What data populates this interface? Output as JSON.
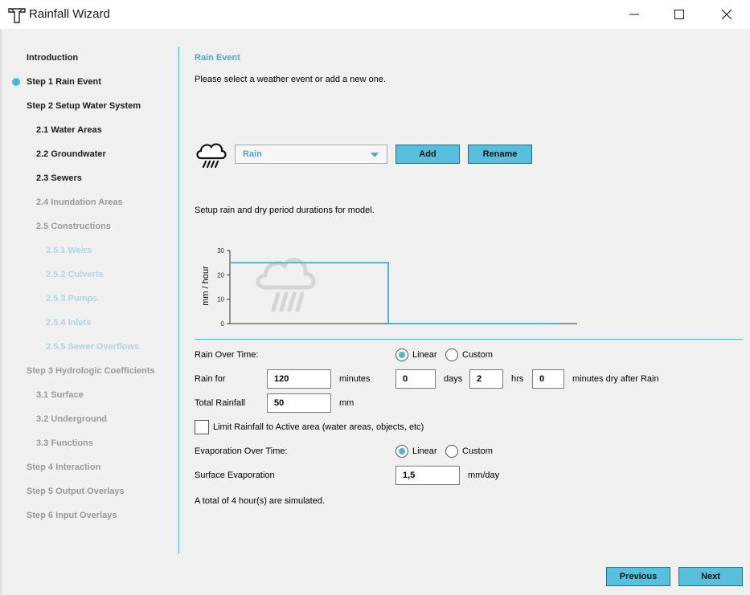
{
  "window": {
    "title": "Rainfall Wizard"
  },
  "sidebar": {
    "items": [
      {
        "label": "Introduction",
        "state": "done"
      },
      {
        "label": "Step 1 Rain Event",
        "state": "current"
      },
      {
        "label": "Step 2 Setup Water System",
        "state": "done"
      },
      {
        "label": "2.1 Water Areas",
        "state": "done"
      },
      {
        "label": "2.2 Groundwater",
        "state": "done"
      },
      {
        "label": "2.3 Sewers",
        "state": "done"
      },
      {
        "label": "2.4 Inundation Areas",
        "state": "future"
      },
      {
        "label": "2.5 Constructions",
        "state": "future"
      },
      {
        "label": "2.5.1 Weirs",
        "state": "disabled"
      },
      {
        "label": "2.5.2 Culverts",
        "state": "disabled"
      },
      {
        "label": "2.5.3 Pumps",
        "state": "disabled"
      },
      {
        "label": "2.5.4 Inlets",
        "state": "disabled"
      },
      {
        "label": "2.5.5 Sewer Overflows",
        "state": "disabled"
      },
      {
        "label": "Step 3 Hydrologic Coefficients",
        "state": "future"
      },
      {
        "label": "3.1 Surface",
        "state": "future"
      },
      {
        "label": "3.2 Underground",
        "state": "future"
      },
      {
        "label": "3.3 Functions",
        "state": "future"
      },
      {
        "label": "Step 4 Interaction",
        "state": "future"
      },
      {
        "label": "Step 5 Output Overlays",
        "state": "future"
      },
      {
        "label": "Step 6 Input Overlays",
        "state": "future"
      }
    ]
  },
  "main": {
    "section_title": "Rain Event",
    "intro": "Please select a weather event or add a new one.",
    "event_select": {
      "value": "Rain"
    },
    "add_label": "Add",
    "rename_label": "Rename",
    "setup_text": "Setup rain and dry period durations for model.",
    "rain_over_time_label": "Rain Over Time:",
    "linear_label": "Linear",
    "custom_label": "Custom",
    "rain_for_label": "Rain for",
    "rain_minutes": "120",
    "minutes_label": "minutes",
    "dry_days": "0",
    "days_label": "days",
    "dry_hrs": "2",
    "hrs_label": "hrs",
    "dry_minutes": "0",
    "dry_after_label": "minutes dry after Rain",
    "total_rainfall_label": "Total Rainfall",
    "total_rainfall": "50",
    "mm_label": "mm",
    "limit_label": "Limit Rainfall to Active area (water areas, objects, etc)",
    "evap_over_time_label": "Evaporation Over Time:",
    "surface_evap_label": "Surface Evaporation",
    "surface_evap": "1,5",
    "mm_day_label": "mm/day",
    "summary": "A total of 4 hour(s) are simulated."
  },
  "chart_data": {
    "type": "line",
    "ylabel": "mm / hour",
    "yticks": [
      "0",
      "10",
      "20",
      "30"
    ],
    "ylim": [
      0,
      30
    ],
    "series": [
      {
        "points": [
          [
            0,
            25
          ],
          [
            0.48,
            25
          ],
          [
            0.48,
            0
          ],
          [
            1,
            0
          ]
        ]
      }
    ],
    "color": "#4fb5d2"
  },
  "footer": {
    "previous_label": "Previous",
    "next_label": "Next"
  },
  "colors": {
    "accent": "#4fb5d2",
    "button": "#57bfdc",
    "disabled_text": "#aed6e4"
  },
  "icons": [
    "app-icon",
    "minimize-icon",
    "maximize-icon",
    "close-icon",
    "rain-cloud-icon",
    "chevron-down-icon"
  ]
}
